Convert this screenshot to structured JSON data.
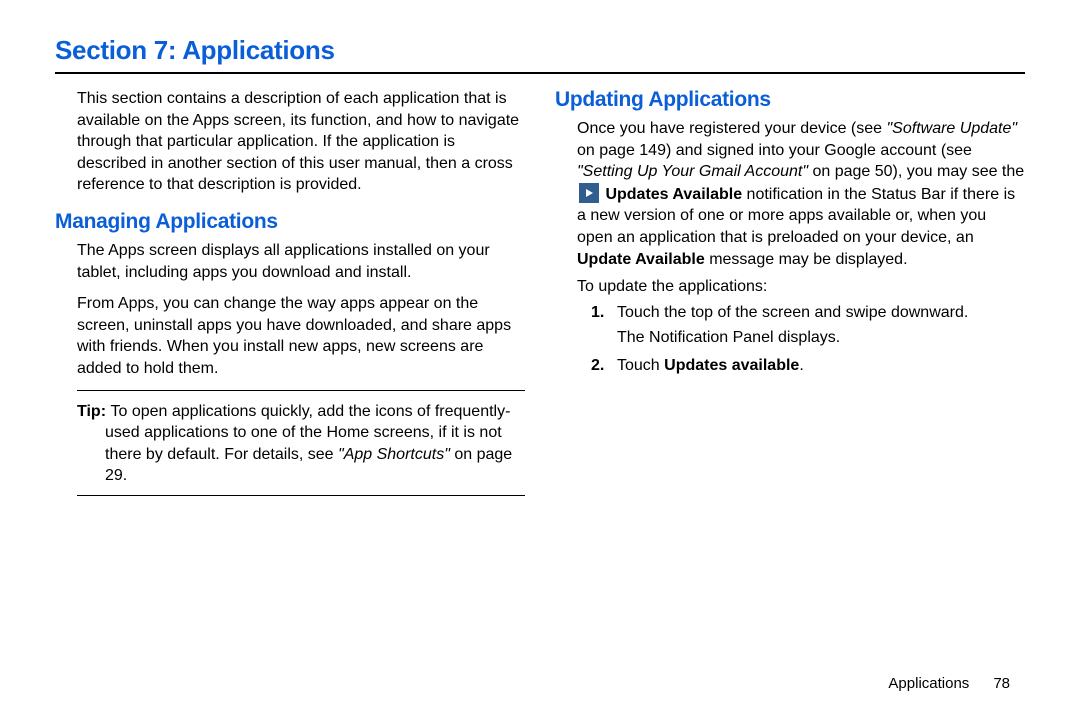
{
  "title": "Section 7: Applications",
  "left": {
    "intro": "This section contains a description of each application that is available on the Apps screen, its function, and how to navigate through that particular application. If the application is described in another section of this user manual, then a cross reference to that description is provided.",
    "heading": "Managing Applications",
    "p1": "The Apps screen displays all applications installed on your tablet, including apps you download and install.",
    "p2": "From Apps, you can change the way apps appear on the screen, uninstall apps you have downloaded, and share apps with friends. When you install new apps, new screens are added to hold them.",
    "tip_label": "Tip: ",
    "tip_head": "To open applications quickly, add the icons of frequently-",
    "tip_line2": "used applications to one of the Home screens, if it is not there by default. For details, see ",
    "tip_ref": "\"App Shortcuts\"",
    "tip_tail": " on page 29."
  },
  "right": {
    "heading": "Updating Applications",
    "seg1": "Once you have registered your device (see ",
    "ref1": "\"Software Update\"",
    "seg2": " on page 149) and signed into your Google account (see ",
    "ref2": "\"Setting Up Your Gmail Account\"",
    "seg3": " on page 50), you may see the ",
    "bold1": "Updates Available",
    "seg4": " notification in the Status Bar if there is a new version of one or more apps available or, when you open an application that is preloaded on your device, an ",
    "bold2": "Update Available",
    "seg5": " message may be displayed.",
    "to_label": "To update the applications:",
    "step1_num": "1.",
    "step1": "Touch the top of the screen and swipe downward.",
    "step1_sub": "The Notification Panel displays.",
    "step2_num": "2.",
    "step2_pre": "Touch ",
    "step2_bold": "Updates available",
    "step2_post": "."
  },
  "footer": {
    "chapter": "Applications",
    "page": "78"
  }
}
